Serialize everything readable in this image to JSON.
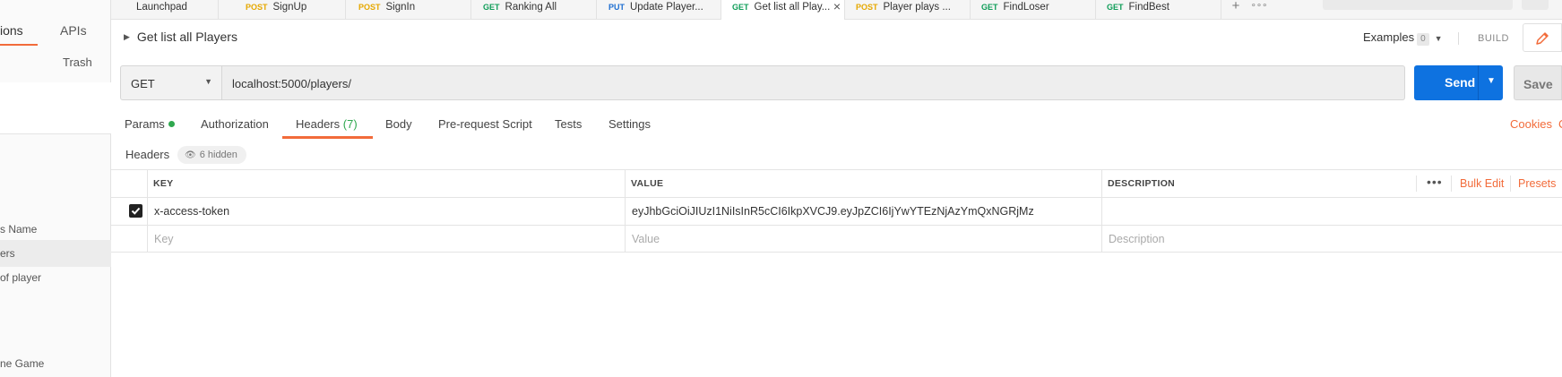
{
  "sidebar": {
    "tab_collections": "ions",
    "tab_apis": "APIs",
    "trash": "Trash",
    "items": [
      {
        "label": "s Name"
      },
      {
        "label": "ers"
      },
      {
        "label": "of player"
      },
      {
        "label": "ne Game"
      }
    ]
  },
  "tabs": [
    {
      "method": "",
      "label": "Launchpad"
    },
    {
      "method": "POST",
      "label": "SignUp"
    },
    {
      "method": "POST",
      "label": "SignIn"
    },
    {
      "method": "GET",
      "label": "Ranking All"
    },
    {
      "method": "PUT",
      "label": "Update Player..."
    },
    {
      "method": "GET",
      "label": "Get list all Play..."
    },
    {
      "method": "POST",
      "label": "Player plays ..."
    },
    {
      "method": "GET",
      "label": "FindLoser"
    },
    {
      "method": "GET",
      "label": "FindBest"
    }
  ],
  "tab_close": "×",
  "tab_plus": "+",
  "tab_more": "∘∘∘",
  "request": {
    "title": "Get list all Players",
    "examples_label": "Examples",
    "examples_count": "0",
    "build_label": "BUILD",
    "method": "GET",
    "url": "localhost:5000/players/",
    "send_label": "Send",
    "save_label": "Save"
  },
  "subtabs": {
    "params": "Params",
    "authorization": "Authorization",
    "headers": "Headers",
    "headers_count": "(7)",
    "body": "Body",
    "prerequest": "Pre-request Script",
    "tests": "Tests",
    "settings": "Settings",
    "cookies": "Cookies",
    "cookies_cut": "C"
  },
  "headers_section": {
    "label": "Headers",
    "hidden_pill": "6 hidden"
  },
  "table": {
    "col_key": "KEY",
    "col_value": "VALUE",
    "col_description": "DESCRIPTION",
    "more": "•••",
    "bulk_edit": "Bulk Edit",
    "presets": "Presets",
    "rows": [
      {
        "key": "x-access-token",
        "value": "eyJhbGciOiJIUzI1NiIsInR5cCI6IkpXVCJ9.eyJpZCI6IjYwYTEzNjAzYmQxNGRjMz",
        "description": "",
        "checked": true
      }
    ],
    "placeholder": {
      "key": "Key",
      "value": "Value",
      "description": "Description"
    }
  }
}
